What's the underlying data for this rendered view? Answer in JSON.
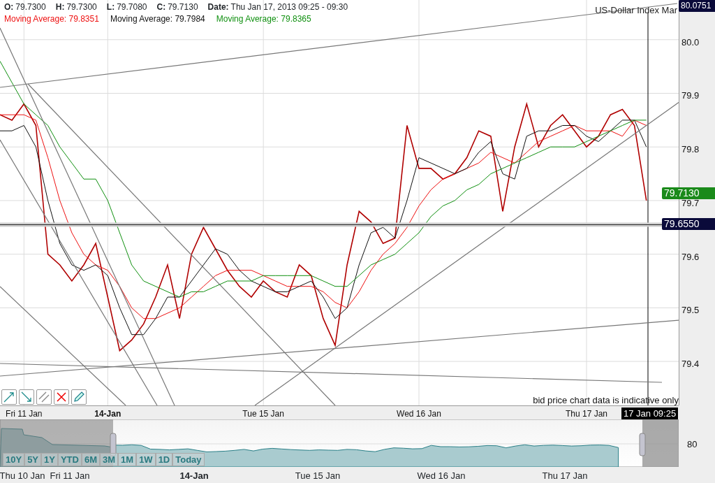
{
  "header": {
    "ohlc": [
      {
        "label": "O:",
        "value": "79.7300"
      },
      {
        "label": "H:",
        "value": "79.7300"
      },
      {
        "label": "L:",
        "value": "79.7080"
      },
      {
        "label": "C:",
        "value": "79.7130"
      }
    ],
    "date_label": "Date:",
    "date_value": "Thu Jan 17, 2013 09:25 - 09:30"
  },
  "chart": {
    "title": "US-Dollar Index Mar",
    "disclaimer": "bid price chart data is indicative only",
    "top_price": "80.0751",
    "last_price": "79.7130",
    "marker_price": "79.6550",
    "cursor_date": "17 Jan 09:25",
    "date_labels_bold": [
      false,
      true,
      false,
      false,
      false
    ],
    "chart_data": {
      "type": "line",
      "grid": true,
      "ylim": [
        79.318,
        80.074
      ],
      "categories": [
        null,
        null,
        "Fri 11 Jan",
        null,
        null,
        null,
        null,
        null,
        null,
        "14-Jan",
        null,
        null,
        null,
        null,
        null,
        null,
        null,
        null,
        null,
        null,
        null,
        null,
        "Tue 15 Jan",
        null,
        null,
        null,
        null,
        null,
        null,
        null,
        null,
        null,
        null,
        null,
        null,
        "Wed 16 Jan",
        null,
        null,
        null,
        null,
        null,
        null,
        null,
        null,
        null,
        null,
        null,
        null,
        null,
        "Thu 17 Jan",
        null,
        null,
        null,
        null,
        null
      ],
      "yticks": [
        {
          "value": 79.4,
          "label": "79.4"
        },
        {
          "value": 79.5,
          "label": "79.5"
        },
        {
          "value": 79.6,
          "label": "79.6"
        },
        {
          "value": 79.7,
          "label": "79.7"
        },
        {
          "value": 79.8,
          "label": "79.8"
        },
        {
          "value": 79.9,
          "label": "79.9"
        },
        {
          "value": 80.0,
          "label": "80.0"
        }
      ],
      "series": [
        {
          "color": "#b00000",
          "values": [
            79.86,
            79.85,
            79.88,
            79.84,
            79.6,
            79.58,
            79.55,
            79.58,
            79.62,
            79.52,
            79.42,
            79.44,
            79.47,
            79.52,
            79.58,
            79.48,
            79.6,
            79.65,
            79.61,
            79.57,
            79.54,
            79.52,
            79.55,
            79.53,
            79.52,
            79.58,
            79.56,
            79.48,
            79.43,
            79.58,
            79.68,
            79.66,
            79.62,
            79.63,
            79.84,
            79.76,
            79.76,
            79.74,
            79.75,
            79.78,
            79.83,
            79.82,
            79.68,
            79.8,
            79.88,
            79.8,
            79.84,
            79.86,
            79.83,
            79.8,
            79.82,
            79.86,
            79.87,
            79.84,
            79.7
          ]
        },
        {
          "name": "Moving Average: 79.8351",
          "color": "#ee1111",
          "values": [
            79.86,
            79.86,
            79.86,
            79.85,
            79.78,
            79.7,
            79.64,
            79.6,
            79.58,
            79.57,
            79.54,
            79.5,
            79.48,
            79.48,
            79.49,
            79.5,
            79.52,
            79.54,
            79.56,
            79.57,
            79.57,
            79.57,
            79.56,
            79.55,
            79.54,
            79.54,
            79.54,
            79.53,
            79.51,
            79.5,
            79.53,
            79.57,
            79.6,
            79.62,
            79.65,
            79.69,
            79.72,
            79.74,
            79.75,
            79.76,
            79.77,
            79.79,
            79.78,
            79.77,
            79.79,
            79.81,
            79.82,
            79.83,
            79.84,
            79.83,
            79.83,
            79.83,
            79.82,
            79.85,
            79.84
          ]
        },
        {
          "name": "Moving Average: 79.7984",
          "color": "#111111",
          "values": [
            79.83,
            79.83,
            79.84,
            79.8,
            79.7,
            79.62,
            79.58,
            79.57,
            79.58,
            79.56,
            79.5,
            79.45,
            79.45,
            79.48,
            79.52,
            79.52,
            79.55,
            79.58,
            79.61,
            79.6,
            79.57,
            79.55,
            79.54,
            79.53,
            79.53,
            79.54,
            79.55,
            79.52,
            79.48,
            79.5,
            79.58,
            79.64,
            79.65,
            79.63,
            79.7,
            79.78,
            79.77,
            79.76,
            79.75,
            79.76,
            79.79,
            79.81,
            79.75,
            79.74,
            79.82,
            79.83,
            79.83,
            79.84,
            79.84,
            79.82,
            79.81,
            79.83,
            79.85,
            79.85,
            79.8
          ]
        },
        {
          "name": "Moving Average: 79.8365",
          "color": "#109010",
          "values": [
            79.96,
            79.92,
            79.88,
            79.86,
            79.84,
            79.8,
            79.77,
            79.74,
            79.74,
            79.7,
            79.64,
            79.58,
            79.55,
            79.54,
            79.53,
            79.52,
            79.53,
            79.53,
            79.54,
            79.55,
            79.55,
            79.55,
            79.56,
            79.56,
            79.56,
            79.56,
            79.56,
            79.55,
            79.54,
            79.54,
            79.56,
            79.58,
            79.59,
            79.6,
            79.62,
            79.64,
            79.67,
            79.69,
            79.7,
            79.72,
            79.73,
            79.75,
            79.76,
            79.77,
            79.78,
            79.79,
            79.8,
            79.8,
            79.8,
            79.81,
            79.82,
            79.83,
            79.84,
            79.85,
            79.85
          ]
        }
      ]
    }
  },
  "drawing_tools": [
    {
      "kind": "trend-up"
    },
    {
      "kind": "trend-down"
    },
    {
      "kind": "parallel"
    },
    {
      "kind": "delete"
    },
    {
      "kind": "pencil"
    }
  ],
  "navigator": {
    "range_buttons": [
      "10Y",
      "5Y",
      "1Y",
      "YTD",
      "6M",
      "3M",
      "1M",
      "1W",
      "1D",
      "Today"
    ],
    "axis_labels": [
      {
        "label": "Thu 10 Jan",
        "bold": false
      },
      {
        "label": "Fri 11 Jan",
        "bold": false
      },
      {
        "label": "14-Jan",
        "bold": true
      },
      {
        "label": "Tue 15 Jan",
        "bold": false
      },
      {
        "label": "Wed 16 Jan",
        "bold": false
      },
      {
        "label": "Thu 17 Jan",
        "bold": false
      }
    ],
    "y_label": "80"
  }
}
